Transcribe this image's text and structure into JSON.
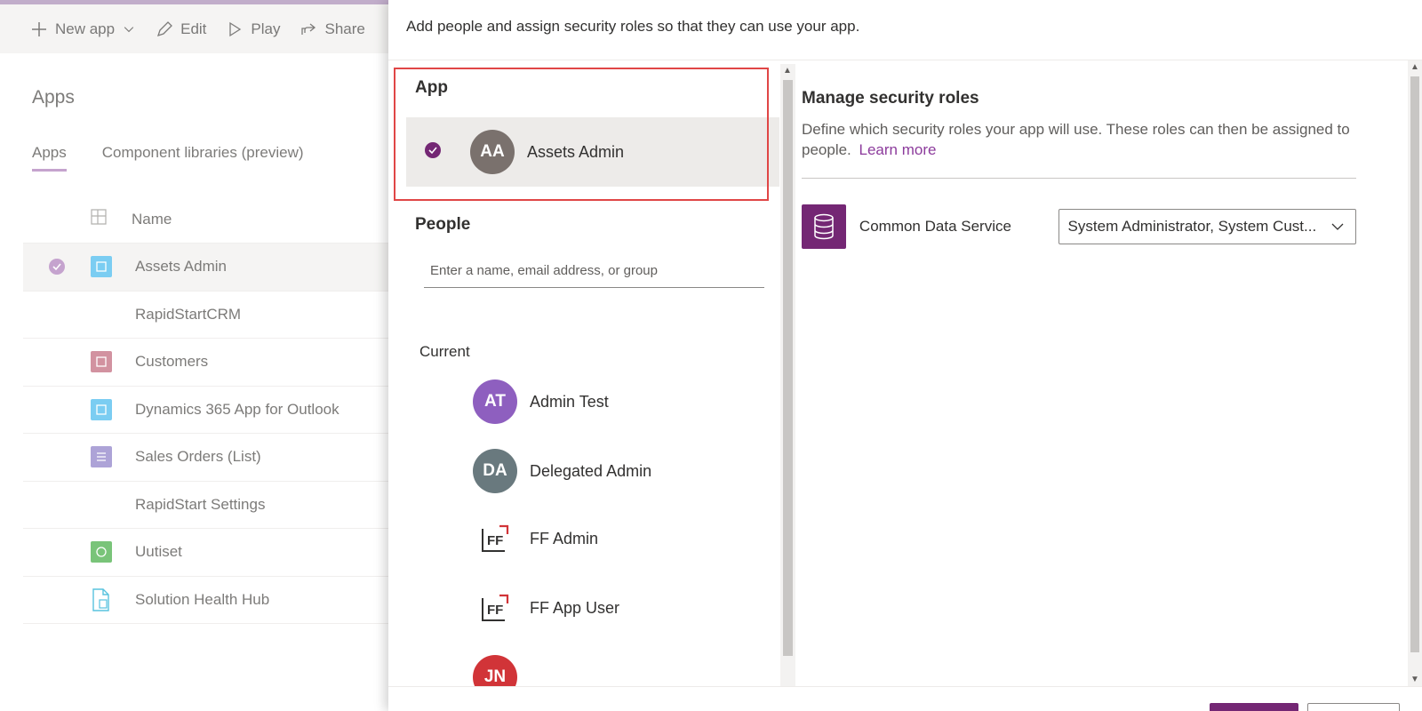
{
  "commandbar": {
    "new_app": "New app",
    "edit": "Edit",
    "play": "Play",
    "share": "Share"
  },
  "page": {
    "title": "Apps",
    "tabs": [
      "Apps",
      "Component libraries (preview)"
    ],
    "name_header": "Name"
  },
  "apps": [
    {
      "name": "Assets Admin",
      "icon": "canvas-app-icon",
      "color": "#5ec3f0",
      "selected": true
    },
    {
      "name": "RapidStartCRM",
      "icon": "none",
      "color": "",
      "selected": false
    },
    {
      "name": "Customers",
      "icon": "canvas-app-icon",
      "color": "#c97a8b",
      "selected": false
    },
    {
      "name": "Dynamics 365 App for Outlook",
      "icon": "canvas-app-icon",
      "color": "#5ec3f0",
      "selected": false
    },
    {
      "name": "Sales Orders (List)",
      "icon": "list-app-icon",
      "color": "#9b8fcf",
      "selected": false
    },
    {
      "name": "RapidStart Settings",
      "icon": "none",
      "color": "",
      "selected": false
    },
    {
      "name": "Uutiset",
      "icon": "globe-app-icon",
      "color": "#5cb85c",
      "selected": false
    },
    {
      "name": "Solution Health Hub",
      "icon": "document-app-icon",
      "color": "#34b6d8",
      "selected": false
    }
  ],
  "panel": {
    "description": "Add people and assign security roles so that they can use your app.",
    "app_section": "App",
    "app_selected": {
      "initials": "AA",
      "name": "Assets Admin"
    },
    "people_section": "People",
    "people_placeholder": "Enter a name, email address, or group",
    "current_label": "Current",
    "current_people": [
      {
        "initials": "AT",
        "name": "Admin Test",
        "color": "#8e5fbf",
        "type": "avatar"
      },
      {
        "initials": "DA",
        "name": "Delegated Admin",
        "color": "#69797e",
        "type": "avatar"
      },
      {
        "initials": "FF",
        "name": "FF Admin",
        "color": "",
        "type": "logo"
      },
      {
        "initials": "FF",
        "name": "FF App User",
        "color": "",
        "type": "logo"
      },
      {
        "initials": "JN",
        "name": "",
        "color": "#d13438",
        "type": "avatar"
      }
    ],
    "manage_title": "Manage security roles",
    "manage_desc": "Define which security roles your app will use. These roles can then be assigned to people.",
    "learn_more": "Learn more",
    "data_service": "Common Data Service",
    "roles_value": "System Administrator, System Cust..."
  },
  "colors": {
    "accent": "#742774",
    "highlight": "#e04646"
  }
}
